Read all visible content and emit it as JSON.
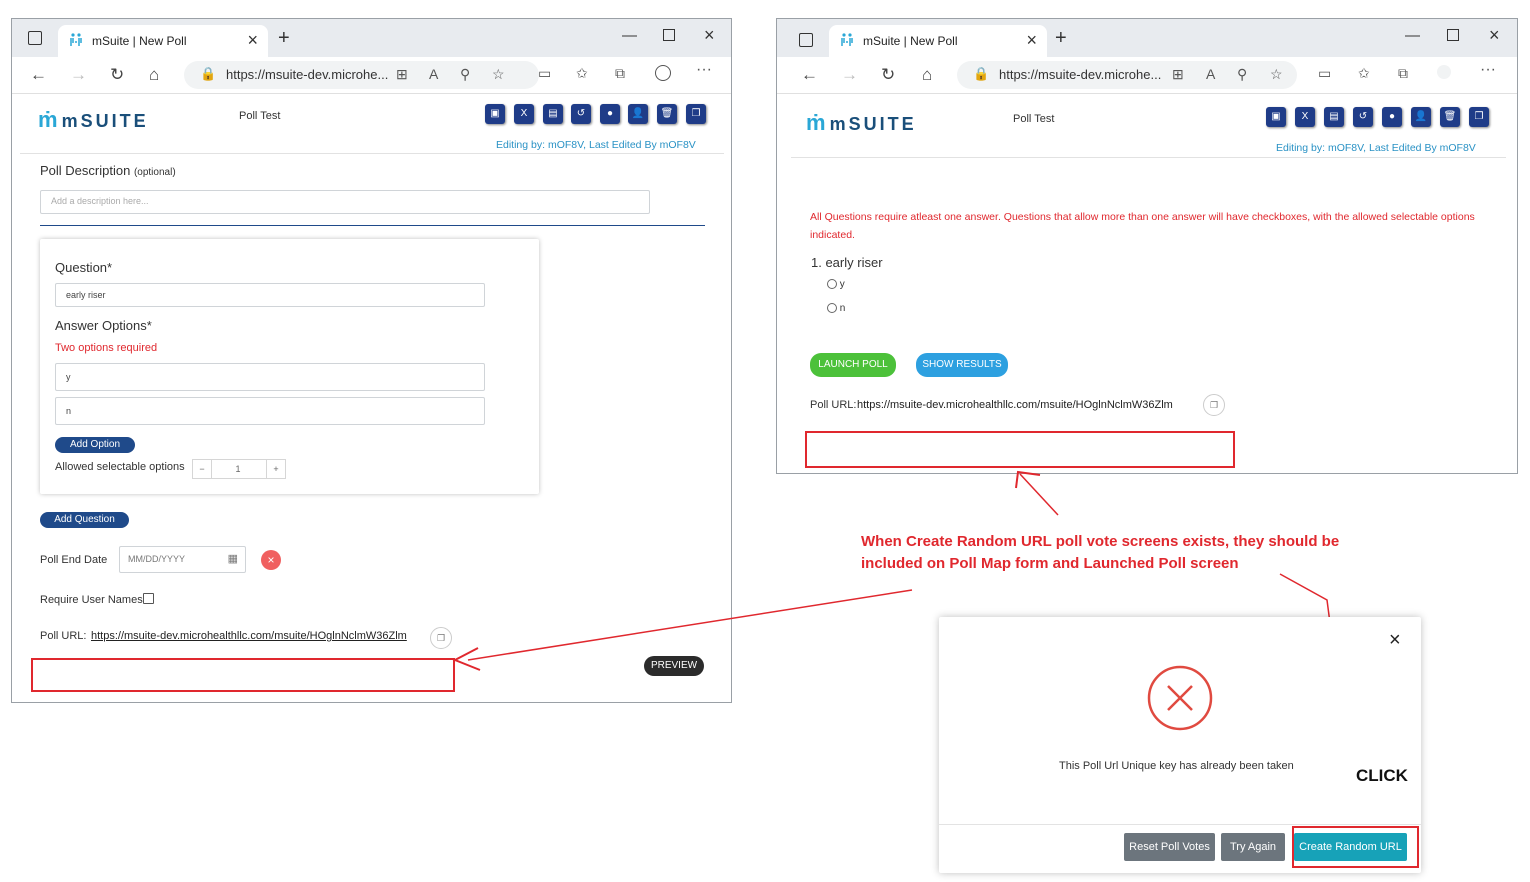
{
  "browser": {
    "tab_title": "mSuite | New Poll",
    "url": "https://msuite-dev.microhe..."
  },
  "app": {
    "logo_text": "mSUITE",
    "poll_title": "Poll Test",
    "editing_info": "Editing by: mOF8V,  Last Edited By mOF8V"
  },
  "editor": {
    "description_label": "Poll Description",
    "description_optional": "(optional)",
    "description_placeholder": "Add a description here...",
    "question_label": "Question*",
    "question_value": "early riser",
    "answer_label": "Answer Options*",
    "answer_error": "Two options required",
    "options": [
      "y",
      "n"
    ],
    "add_option": "Add Option",
    "allowed_label": "Allowed selectable options",
    "stepper_minus": "−",
    "stepper_value": "1",
    "stepper_plus": "+",
    "add_question": "Add Question",
    "end_date_label": "Poll End Date",
    "end_date_placeholder": "MM/DD/YYYY",
    "require_names_label": "Require User Names",
    "poll_url_label": "Poll URL:",
    "poll_url": "https://msuite-dev.microhealthllc.com/msuite/HOglnNclmW36Zlm",
    "preview": "PREVIEW"
  },
  "launched": {
    "notice": "All Questions require atleast one answer. Questions that allow more than one answer will have checkboxes, with the allowed selectable options indicated.",
    "question": "1. early riser",
    "options": [
      "y",
      "n"
    ],
    "launch": "LAUNCH POLL",
    "show_results": "SHOW RESULTS",
    "poll_url_label": "Poll URL:",
    "poll_url": "https://msuite-dev.microhealthllc.com/msuite/HOglnNclmW36Zlm"
  },
  "annotation": {
    "line1": "When Create Random URL poll vote screens exists, they should be",
    "line2": "included on Poll Map form and Launched Poll screen",
    "click": "CLICK"
  },
  "modal": {
    "message": "This Poll Url Unique key has already been taken",
    "close": "×",
    "reset": "Reset Poll Votes",
    "try_again": "Try Again",
    "create_random": "Create Random URL"
  },
  "colors": {
    "brand_blue": "#1f3c88",
    "accent_blue": "#2a92c5",
    "error_red": "#e0282e",
    "green": "#4cc13a",
    "teal": "#17a2b8",
    "gray_btn": "#6c757d"
  }
}
